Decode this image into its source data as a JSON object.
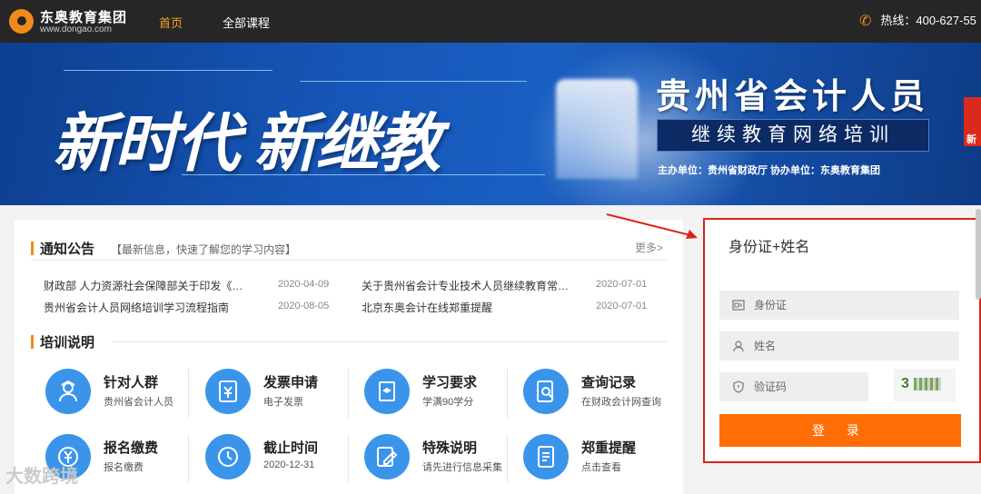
{
  "header": {
    "logo_name": "东奥教育集团",
    "logo_url": "www.dongao.com",
    "nav": [
      {
        "label": "首页",
        "active": true
      },
      {
        "label": "全部课程",
        "active": false
      }
    ],
    "hotline": "热线：400-627-55"
  },
  "banner": {
    "slogan": "新时代  新继教",
    "title": "贵州省会计人员",
    "subtitle": "继续教育网络培训",
    "organizer": "主办单位：贵州省财政厅    协办单位：东奥教育集团",
    "side_badge": "新"
  },
  "notices": {
    "title": "通知公告",
    "hint": "【最新信息，快速了解您的学习内容】",
    "more": "更多>",
    "items": [
      {
        "title": "财政部 人力资源社会保障部关于印发《…",
        "date": "2020-04-09"
      },
      {
        "title": "关于贵州省会计专业技术人员继续教育常…",
        "date": "2020-07-01"
      },
      {
        "title": "贵州省会计人员网络培训学习流程指南",
        "date": "2020-08-05"
      },
      {
        "title": "北京东奥会计在线郑重提醒",
        "date": "2020-07-01"
      }
    ]
  },
  "training": {
    "title": "培训说明",
    "features": [
      {
        "title": "针对人群",
        "sub": "贵州省会计人员",
        "icon": "person-icon"
      },
      {
        "title": "发票申请",
        "sub": "电子发票",
        "icon": "invoice-icon"
      },
      {
        "title": "学习要求",
        "sub": "学满90学分",
        "icon": "book-icon"
      },
      {
        "title": "查询记录",
        "sub": "在财政会计网查询",
        "icon": "search-doc-icon"
      },
      {
        "title": "报名缴费",
        "sub": "报名缴费",
        "icon": "yuan-icon"
      },
      {
        "title": "截止时间",
        "sub": "2020-12-31",
        "icon": "clock-icon"
      },
      {
        "title": "特殊说明",
        "sub": "请先进行信息采集",
        "icon": "edit-icon"
      },
      {
        "title": "郑重提醒",
        "sub": "点击查看",
        "icon": "note-icon"
      }
    ]
  },
  "login": {
    "title": "身份证+姓名",
    "id_placeholder": "身份证",
    "name_placeholder": "姓名",
    "captcha_placeholder": "验证码",
    "captcha_text": "3",
    "submit": "登 录"
  },
  "watermark": "大数跨境",
  "colors": {
    "accent": "#f08a1c",
    "button": "#fe6d06",
    "highlight_border": "#d9241a",
    "icon_blue": "#3a94ea"
  }
}
